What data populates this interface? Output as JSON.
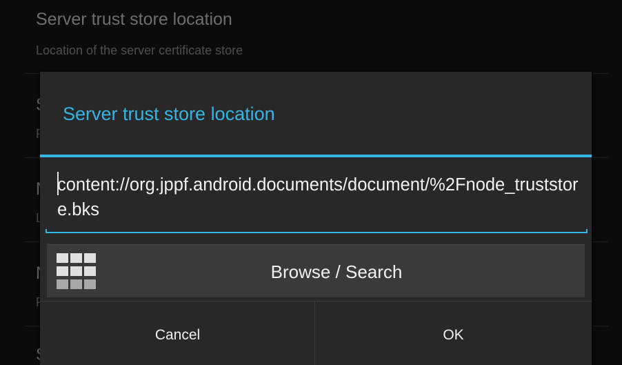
{
  "background_list": {
    "items": [
      {
        "title": "Server trust store location",
        "summary": "Location of the server certificate store"
      },
      {
        "title": "S",
        "summary": "P"
      },
      {
        "title": "N",
        "summary": "L"
      },
      {
        "title": "N",
        "summary": "P"
      },
      {
        "title": "S",
        "summary": ""
      }
    ]
  },
  "dialog": {
    "title": "Server trust store location",
    "field_value": "content://org.jppf.android.documents/document/%2Fnode_truststore.bks",
    "browse_label": "Browse / Search",
    "browse_icon": "grid-icon",
    "cancel_label": "Cancel",
    "ok_label": "OK"
  },
  "colors": {
    "accent": "#33b5e5",
    "dialog_background": "#282828",
    "button_background": "#3a3a3a"
  }
}
